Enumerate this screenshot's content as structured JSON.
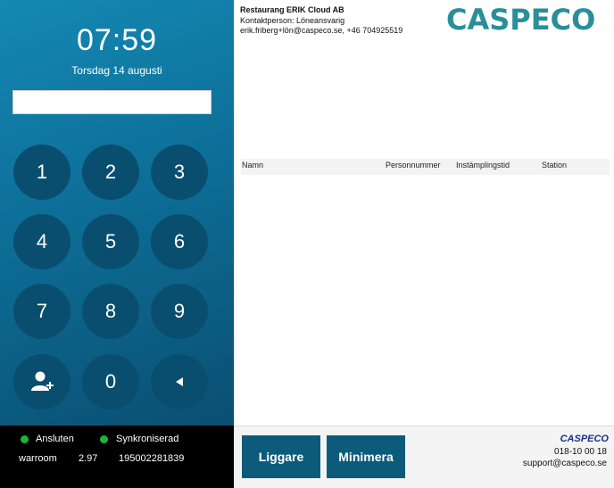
{
  "clock": {
    "time": "07:59",
    "date": "Torsdag 14 augusti"
  },
  "pin": {
    "value": "",
    "placeholder": ""
  },
  "keypad": {
    "keys": [
      "1",
      "2",
      "3",
      "4",
      "5",
      "6",
      "7",
      "8",
      "9"
    ],
    "zero": "0",
    "add_user_icon": "add-user-icon",
    "backspace_icon": "backspace-triangle-icon"
  },
  "status": {
    "connected_label": "Ansluten",
    "synced_label": "Synkroniserad",
    "station": "warroom",
    "version": "2.97",
    "id": "195002281839",
    "indicator_color": "#1db33a"
  },
  "header": {
    "company": "Restaurang ERIK Cloud AB",
    "contact": "Kontaktperson: Löneansvarig",
    "email_phone": "erik.friberg+lön@caspeco.se, +46 704925519",
    "logo_text": "CASPECO",
    "logo_color": "#2a8f99"
  },
  "table": {
    "columns": [
      "Namn",
      "Personnummer",
      "Instämplingstid",
      "Station"
    ],
    "rows": []
  },
  "footer": {
    "liggare_label": "Liggare",
    "minimera_label": "Minimera",
    "logo_text": "CASPECO",
    "phone": "018-10 00 18",
    "email": "support@caspeco.se",
    "button_color": "#0d5b7b"
  }
}
